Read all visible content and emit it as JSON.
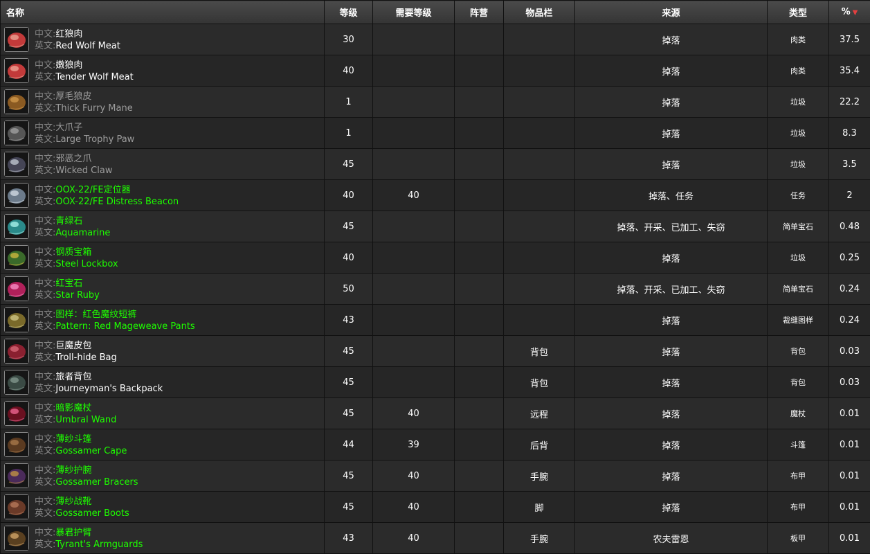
{
  "headers": {
    "name": "名称",
    "level": "等级",
    "req_level": "需要等级",
    "faction": "阵营",
    "slot": "物品栏",
    "source": "来源",
    "type": "类型",
    "percent": "%"
  },
  "labels": {
    "cn": "中文:",
    "en": "英文:"
  },
  "colors": {
    "white": "#ffffff",
    "gray": "#9d9d9d",
    "green": "#1eff00",
    "label": "#888888"
  },
  "items": [
    {
      "cn": "红狼肉",
      "en": "Red Wolf Meat",
      "quality": "white",
      "icon": "meat-icon",
      "level": "30",
      "req": "",
      "faction": "",
      "slot": "",
      "source": "掉落",
      "type": "肉类",
      "pct": "37.5"
    },
    {
      "cn": "嫩狼肉",
      "en": "Tender Wolf Meat",
      "quality": "white",
      "icon": "meat-icon",
      "level": "40",
      "req": "",
      "faction": "",
      "slot": "",
      "source": "掉落",
      "type": "肉类",
      "pct": "35.4"
    },
    {
      "cn": "厚毛狼皮",
      "en": "Thick Furry Mane",
      "quality": "gray",
      "icon": "fur-icon",
      "level": "1",
      "req": "",
      "faction": "",
      "slot": "",
      "source": "掉落",
      "type": "垃圾",
      "pct": "22.2"
    },
    {
      "cn": "大爪子",
      "en": "Large Trophy Paw",
      "quality": "gray",
      "icon": "paw-icon",
      "level": "1",
      "req": "",
      "faction": "",
      "slot": "",
      "source": "掉落",
      "type": "垃圾",
      "pct": "8.3"
    },
    {
      "cn": "邪恶之爪",
      "en": "Wicked Claw",
      "quality": "gray",
      "icon": "claw-icon",
      "level": "45",
      "req": "",
      "faction": "",
      "slot": "",
      "source": "掉落",
      "type": "垃圾",
      "pct": "3.5"
    },
    {
      "cn": "OOX-22/FE定位器",
      "en": "OOX-22/FE Distress Beacon",
      "quality": "green",
      "icon": "beacon-icon",
      "level": "40",
      "req": "40",
      "faction": "",
      "slot": "",
      "source": "掉落、任务",
      "type": "任务",
      "pct": "2"
    },
    {
      "cn": "青绿石",
      "en": "Aquamarine",
      "quality": "green",
      "icon": "gem-icon",
      "level": "45",
      "req": "",
      "faction": "",
      "slot": "",
      "source": "掉落、开采、已加工、失窃",
      "type": "简单宝石",
      "pct": "0.48"
    },
    {
      "cn": "钢质宝箱",
      "en": "Steel Lockbox",
      "quality": "green",
      "icon": "lockbox-icon",
      "level": "40",
      "req": "",
      "faction": "",
      "slot": "",
      "source": "掉落",
      "type": "垃圾",
      "pct": "0.25"
    },
    {
      "cn": "红宝石",
      "en": "Star Ruby",
      "quality": "green",
      "icon": "ruby-icon",
      "level": "50",
      "req": "",
      "faction": "",
      "slot": "",
      "source": "掉落、开采、已加工、失窃",
      "type": "简单宝石",
      "pct": "0.24"
    },
    {
      "cn": "图样：红色魔纹短裤",
      "en": "Pattern: Red Mageweave Pants",
      "quality": "green",
      "icon": "pattern-icon",
      "level": "43",
      "req": "",
      "faction": "",
      "slot": "",
      "source": "掉落",
      "type": "裁缝图样",
      "pct": "0.24"
    },
    {
      "cn": "巨魔皮包",
      "en": "Troll-hide Bag",
      "quality": "white",
      "icon": "bag-icon",
      "level": "45",
      "req": "",
      "faction": "",
      "slot": "背包",
      "source": "掉落",
      "type": "背包",
      "pct": "0.03"
    },
    {
      "cn": "旅者背包",
      "en": "Journeyman's Backpack",
      "quality": "white",
      "icon": "backpack-icon",
      "level": "45",
      "req": "",
      "faction": "",
      "slot": "背包",
      "source": "掉落",
      "type": "背包",
      "pct": "0.03"
    },
    {
      "cn": "暗影魔杖",
      "en": "Umbral Wand",
      "quality": "green",
      "icon": "wand-icon",
      "level": "45",
      "req": "40",
      "faction": "",
      "slot": "远程",
      "source": "掉落",
      "type": "魔杖",
      "pct": "0.01"
    },
    {
      "cn": "薄纱斗篷",
      "en": "Gossamer Cape",
      "quality": "green",
      "icon": "cape-icon",
      "level": "44",
      "req": "39",
      "faction": "",
      "slot": "后背",
      "source": "掉落",
      "type": "斗篷",
      "pct": "0.01"
    },
    {
      "cn": "薄纱护腕",
      "en": "Gossamer Bracers",
      "quality": "green",
      "icon": "bracers-icon",
      "level": "45",
      "req": "40",
      "faction": "",
      "slot": "手腕",
      "source": "掉落",
      "type": "布甲",
      "pct": "0.01"
    },
    {
      "cn": "薄纱战靴",
      "en": "Gossamer Boots",
      "quality": "green",
      "icon": "boots-icon",
      "level": "45",
      "req": "40",
      "faction": "",
      "slot": "脚",
      "source": "掉落",
      "type": "布甲",
      "pct": "0.01"
    },
    {
      "cn": "暴君护臂",
      "en": "Tyrant's Armguards",
      "quality": "green",
      "icon": "armguards-icon",
      "level": "43",
      "req": "40",
      "faction": "",
      "slot": "手腕",
      "source": "农夫雷恩",
      "type": "板甲",
      "pct": "0.01"
    }
  ]
}
